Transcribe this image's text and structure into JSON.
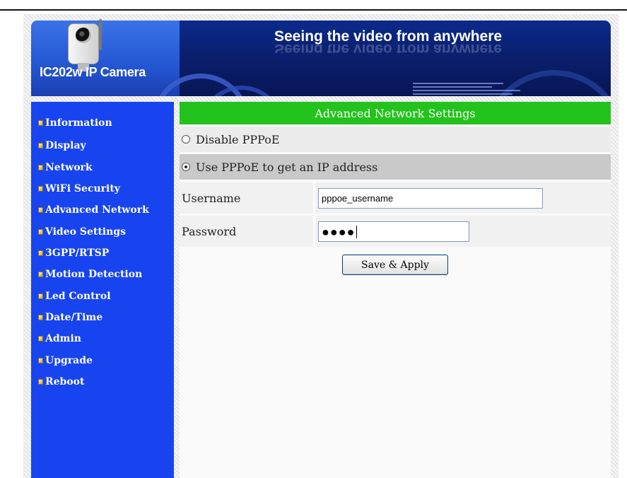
{
  "header": {
    "camera_title": "IC202w IP Camera",
    "slogan": "Seeing the video from anywhere"
  },
  "sidebar": {
    "items": [
      {
        "label": "Information"
      },
      {
        "label": "Display"
      },
      {
        "label": "Network"
      },
      {
        "label": "WiFi Security"
      },
      {
        "label": "Advanced Network"
      },
      {
        "label": "Video Settings"
      },
      {
        "label": "3GPP/RTSP"
      },
      {
        "label": "Motion Detection"
      },
      {
        "label": "Led Control"
      },
      {
        "label": "Date/Time"
      },
      {
        "label": "Admin"
      },
      {
        "label": "Upgrade"
      },
      {
        "label": "Reboot"
      }
    ]
  },
  "main": {
    "title": "Advanced Network Settings",
    "options": [
      {
        "label": "Disable PPPoE",
        "selected": false
      },
      {
        "label": "Use PPPoE to get an IP address",
        "selected": true
      }
    ],
    "fields": {
      "username": {
        "label": "Username",
        "value": "pppoe_username"
      },
      "password": {
        "label": "Password",
        "value": "●●●●"
      }
    },
    "save_label": "Save & Apply"
  },
  "colors": {
    "title_bar": "#23c21c",
    "sidebar": "#1844f0",
    "banner": "#0a1f6e"
  }
}
